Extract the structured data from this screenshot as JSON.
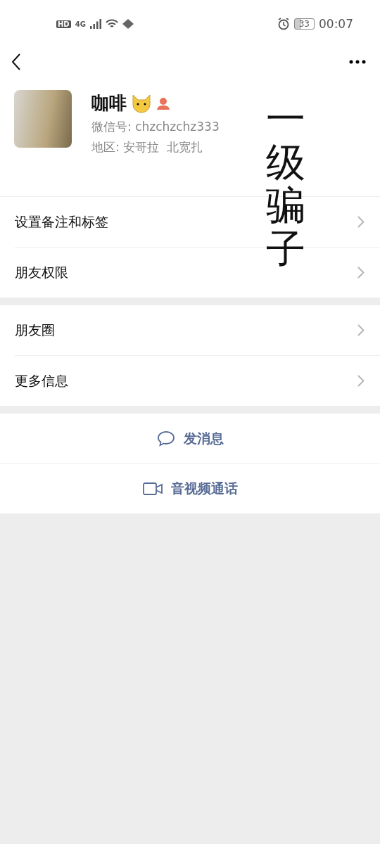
{
  "status_bar": {
    "hd": "HD",
    "network": "4G",
    "battery": "33",
    "time": "00:07"
  },
  "profile": {
    "name": "咖啡",
    "wechat_id": "微信号: chzchzchz333",
    "region": "地区: 安哥拉  北宽扎"
  },
  "annotation": {
    "text": "一级骗子"
  },
  "menu_groups": [
    {
      "items": [
        {
          "label": "设置备注和标签"
        },
        {
          "label": "朋友权限"
        }
      ]
    },
    {
      "items": [
        {
          "label": "朋友圈"
        },
        {
          "label": "更多信息"
        }
      ]
    }
  ],
  "actions": [
    {
      "kind": "message",
      "label": "发消息"
    },
    {
      "kind": "call",
      "label": "音视频通话"
    }
  ]
}
